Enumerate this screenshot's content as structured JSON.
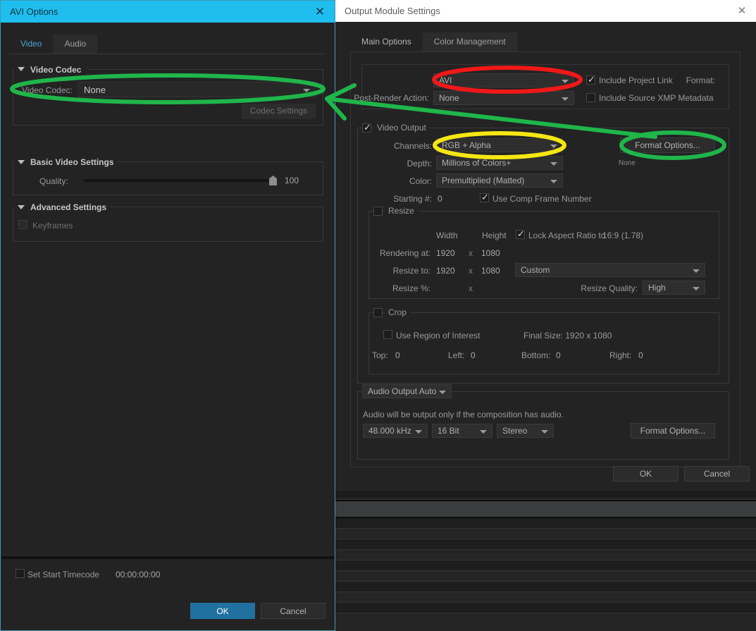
{
  "avi_dialog": {
    "title": "AVI Options",
    "close_icon": "close-icon",
    "tabs": [
      {
        "label": "Video",
        "active": true
      },
      {
        "label": "Audio",
        "active": false
      }
    ],
    "sections": {
      "video_codec": {
        "header": "Video Codec",
        "codec_label": "Video Codec:",
        "codec_value": "None",
        "codec_settings_button": "Codec Settings"
      },
      "basic_video_settings": {
        "header": "Basic Video Settings",
        "quality_label": "Quality:",
        "quality_value": "100"
      },
      "advanced_settings": {
        "header": "Advanced Settings",
        "keyframes_label": "Keyframes",
        "keyframes_checked": false
      }
    },
    "footer": {
      "set_start_timecode_label": "Set Start Timecode",
      "set_start_timecode_checked": false,
      "timecode_value": "00:00:00:00",
      "ok_label": "OK",
      "cancel_label": "Cancel"
    }
  },
  "oms_dialog": {
    "title": "Output Module Settings",
    "close_icon": "close-icon",
    "tabs": [
      {
        "label": "Main Options",
        "active": true
      },
      {
        "label": "Color Management",
        "active": false
      }
    ],
    "main": {
      "format_label": "Format:",
      "format_value": "AVI",
      "post_render_label": "Post-Render Action:",
      "post_render_value": "None",
      "include_project_link_label": "Include Project Link",
      "include_project_link_checked": true,
      "include_xmp_label": "Include Source XMP Metadata",
      "include_xmp_checked": false
    },
    "video_output": {
      "legend": "Video Output",
      "checked": true,
      "channels_label": "Channels:",
      "channels_value": "RGB + Alpha",
      "depth_label": "Depth:",
      "depth_value": "Millions of Colors+",
      "color_label": "Color:",
      "color_value": "Premultiplied (Matted)",
      "starting_label": "Starting #:",
      "starting_value": "0",
      "use_comp_frame_label": "Use Comp Frame Number",
      "use_comp_frame_checked": true,
      "format_options_button": "Format Options...",
      "format_options_status": "None",
      "resize": {
        "legend": "Resize",
        "checked": false,
        "width_header": "Width",
        "height_header": "Height",
        "lock_aspect_label": "Lock Aspect Ratio to",
        "lock_aspect_value": "16:9 (1.78)",
        "lock_aspect_checked": true,
        "rendering_at_label": "Rendering at:",
        "rendering_width": "1920",
        "rendering_sep": "x",
        "rendering_height": "1080",
        "resize_to_label": "Resize to:",
        "resize_width": "1920",
        "resize_sep": "x",
        "resize_height": "1080",
        "resize_preset": "Custom",
        "resize_pct_label": "Resize %:",
        "resize_pct_sep": "x",
        "resize_quality_label": "Resize Quality:",
        "resize_quality_value": "High"
      },
      "crop": {
        "legend": "Crop",
        "checked": false,
        "use_roi_label": "Use Region of Interest",
        "use_roi_checked": false,
        "final_size_label": "Final Size: 1920 x 1080",
        "top_label": "Top:",
        "top_value": "0",
        "left_label": "Left:",
        "left_value": "0",
        "bottom_label": "Bottom:",
        "bottom_value": "0",
        "right_label": "Right:",
        "right_value": "0"
      }
    },
    "audio_output": {
      "mode_value": "Audio Output Auto",
      "note": "Audio will be output only if the composition has audio.",
      "rate_value": "48.000 kHz",
      "depth_value": "16 Bit",
      "channels_value": "Stereo",
      "format_options_button": "Format Options..."
    },
    "footer": {
      "ok_label": "OK",
      "cancel_label": "Cancel"
    }
  },
  "annotations": {
    "green": "#1fb64a",
    "red": "#f01818",
    "yellow": "#f5e614",
    "items": [
      {
        "name": "video-codec-highlight",
        "shape": "ellipse",
        "color": "#1fb64a"
      },
      {
        "name": "format-highlight",
        "shape": "ellipse",
        "color": "#f01818"
      },
      {
        "name": "channels-highlight",
        "shape": "ellipse",
        "color": "#f5e614"
      },
      {
        "name": "format-options-highlight",
        "shape": "ellipse",
        "color": "#1fb64a"
      },
      {
        "name": "connector-arrow",
        "shape": "arrow",
        "color": "#1fb64a"
      }
    ]
  }
}
